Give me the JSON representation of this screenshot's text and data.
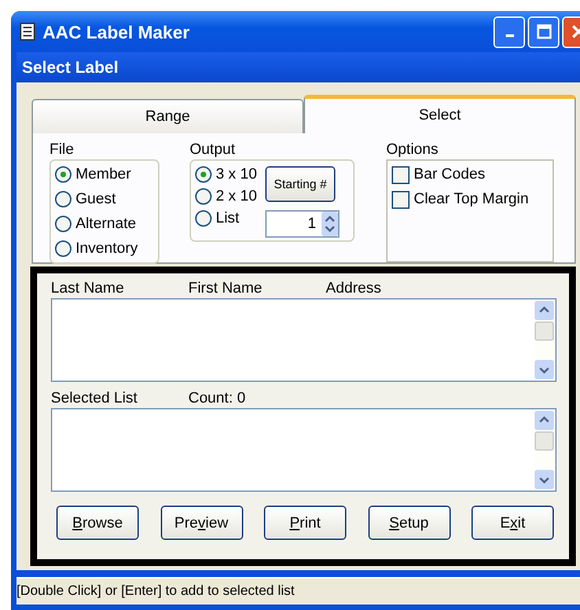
{
  "window": {
    "title": "AAC Label Maker"
  },
  "dialog": {
    "title": "Select Label"
  },
  "tabs": [
    {
      "label": "Range",
      "selected": false
    },
    {
      "label": "Select",
      "selected": true
    }
  ],
  "file_group": {
    "title": "File",
    "options": [
      {
        "label": "Member",
        "selected": true
      },
      {
        "label": "Guest",
        "selected": false
      },
      {
        "label": "Alternate",
        "selected": false
      },
      {
        "label": "Inventory",
        "selected": false
      }
    ]
  },
  "output_group": {
    "title": "Output",
    "options": [
      {
        "label": "3 x 10",
        "selected": true
      },
      {
        "label": "2 x 10",
        "selected": false
      },
      {
        "label": "List",
        "selected": false
      }
    ],
    "starting_button": "Starting #",
    "starting_value": "1"
  },
  "options_group": {
    "title": "Options",
    "checkboxes": [
      {
        "label": "Bar Codes",
        "checked": false
      },
      {
        "label": "Clear Top Margin",
        "checked": false
      }
    ]
  },
  "list": {
    "columns": [
      "Last Name",
      "First Name",
      "Address"
    ]
  },
  "selected_list": {
    "label": "Selected List",
    "count": "Count: 0"
  },
  "buttons": [
    {
      "key": "B",
      "after": "rowse"
    },
    {
      "before": "Pre",
      "key": "v",
      "after": "iew"
    },
    {
      "key": "P",
      "after": "rint"
    },
    {
      "key": "S",
      "after": "etup"
    },
    {
      "before": "E",
      "key": "x",
      "after": "it"
    }
  ],
  "status_bar": "[Double Click] or [Enter] to add to selected list"
}
